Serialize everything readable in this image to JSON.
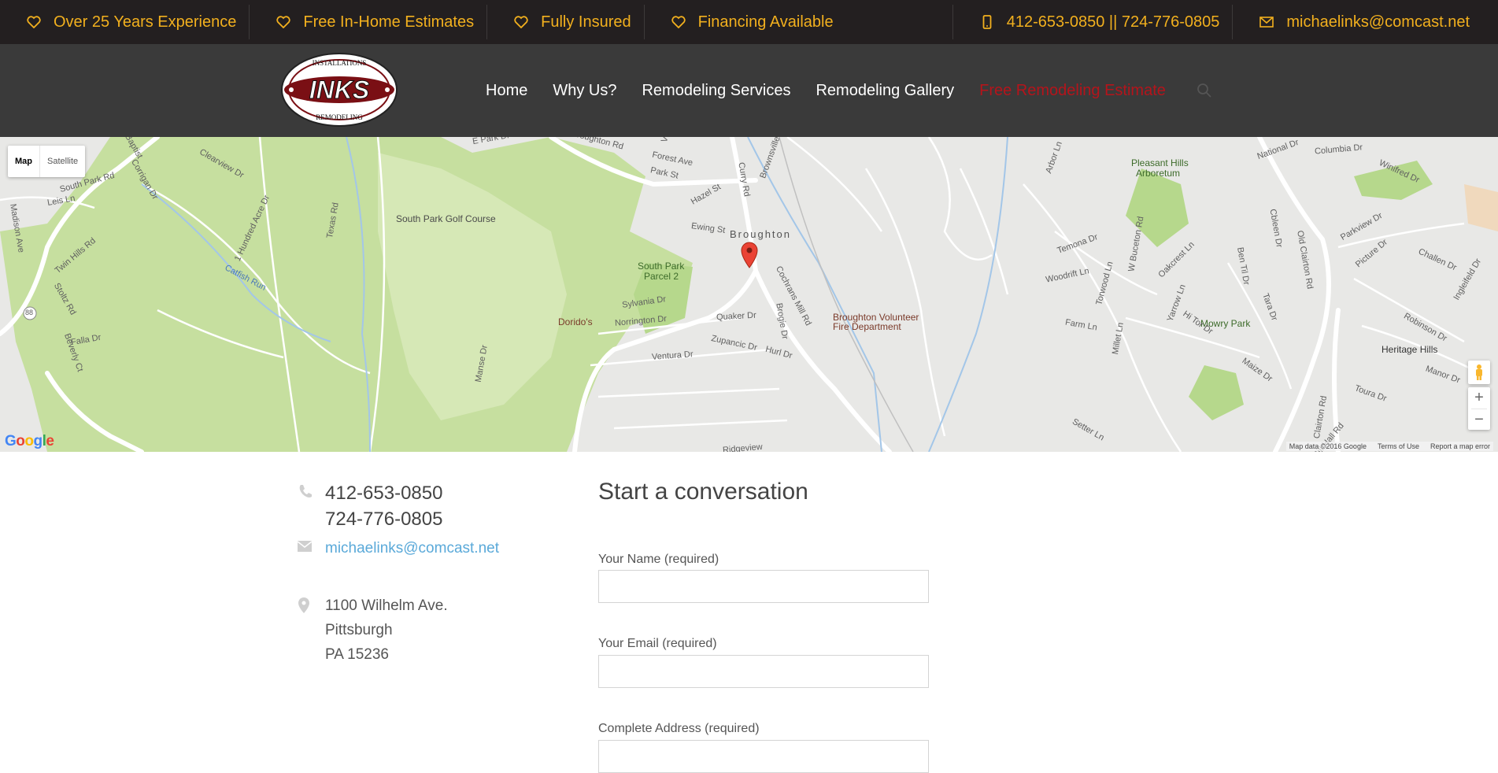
{
  "topbar": {
    "features": [
      {
        "label": "Over 25 Years Experience",
        "icon": "heart-icon"
      },
      {
        "label": "Free In-Home Estimates",
        "icon": "heart-icon"
      },
      {
        "label": "Fully Insured",
        "icon": "heart-icon"
      },
      {
        "label": "Financing Available",
        "icon": "heart-icon"
      }
    ],
    "phone": "412-653-0850 || 724-776-0805",
    "email": "michaelinks@comcast.net",
    "accent_color": "#f2b01e"
  },
  "logo": {
    "top_text": "INSTALLATIONS",
    "main_text": "INKS",
    "bottom_text": "REMODELING"
  },
  "nav": {
    "items": [
      "Home",
      "Why Us?",
      "Remodeling Services",
      "Remodeling Gallery",
      "Free Remodeling Estimate"
    ],
    "active_color": "#b5141b"
  },
  "map": {
    "type_options": [
      "Map",
      "Satellite"
    ],
    "selected_type": "Map",
    "labels": {
      "broughton": "Broughton",
      "golf": "South Park Golf Course",
      "park2a": "South Park",
      "park2b": "Parcel 2",
      "pleasant1": "Pleasant Hills",
      "pleasant2": "Arboretum",
      "mowry": "Mowry Park",
      "fire1": "Broughton Volunteer",
      "fire2": "Fire Department",
      "dorido": "Dorido's",
      "heritage": "Heritage Hills",
      "catfish": "Catfish Run",
      "route": "88"
    },
    "streets": [
      "Broughton Rd",
      "E Park Dr",
      "Forest Ave",
      "Park St",
      "Villa Dr",
      "Brownsville Rd",
      "Curry Rd",
      "Hazel St",
      "Ewing St",
      "South Park Rd",
      "Leis Ln",
      "Madison Ave",
      "Twin Hills Rd",
      "Stoltz Rd",
      "Corrigan Dr",
      "1 Hundred Acre Dr",
      "Texas Rd",
      "Cochrans Mill Rd",
      "Brogie Dr",
      "Sylvania Dr",
      "Norrington Dr",
      "Quaker Dr",
      "Zupancic Dr",
      "Ventura Dr",
      "Hurl Dr",
      "Manse Dr",
      "Falla Dr",
      "Beverly Ct",
      "Clearview Dr",
      "Baptist",
      "Arbor Ln",
      "Temona Dr",
      "Woodrift Ln",
      "W Buceton Rd",
      "Torwood Ln",
      "Farm Ln",
      "Millet Ln",
      "Oakcrest Ln",
      "Yarrow Ln",
      "Hi Tor Dr",
      "Ben Til Dr",
      "Cbleen Dr",
      "Tara Dr",
      "Old Clairton Rd",
      "Clairton Rd",
      "Gill Hall Rd",
      "Maize Dr",
      "Toura Dr",
      "Parkview Dr",
      "Picture Dr",
      "Challen Dr",
      "Ingleifeld Dr",
      "Robinson Dr",
      "Manor Dr",
      "National Dr",
      "Columbia Dr",
      "Winifred Dr",
      "Setter Ln",
      "Ridgeview"
    ],
    "attribution": [
      "Map data ©2016 Google",
      "Terms of Use",
      "Report a map error"
    ],
    "zoom_in": "+",
    "zoom_out": "−",
    "google_logo": "Google"
  },
  "contact": {
    "phone1": "412-653-0850",
    "phone2": "724-776-0805",
    "email": "michaelinks@comcast.net",
    "address_line1": "1100 Wilhelm Ave.",
    "address_line2": "Pittsburgh",
    "address_line3": "PA 15236"
  },
  "form": {
    "title": "Start a conversation",
    "name_label": "Your Name (required)",
    "email_label": "Your Email (required)",
    "address_label": "Complete Address (required)"
  }
}
